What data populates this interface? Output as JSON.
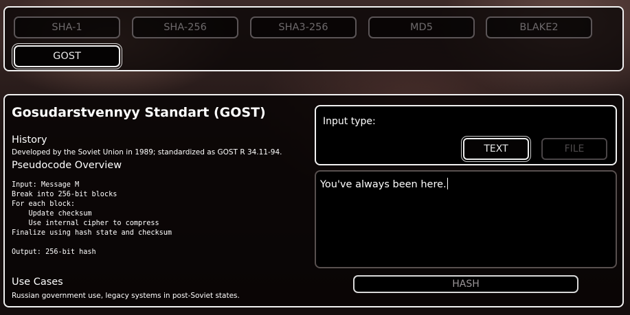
{
  "algorithms": {
    "items": [
      {
        "label": "SHA-1"
      },
      {
        "label": "SHA-256"
      },
      {
        "label": "SHA3-256"
      },
      {
        "label": "MD5"
      },
      {
        "label": "BLAKE2"
      },
      {
        "label": "GOST"
      }
    ],
    "selected": "GOST"
  },
  "info": {
    "title": "Gosudarstvennyy Standart (GOST)",
    "history_heading": "History",
    "history_text": "Developed by the Soviet Union in 1989; standardized as GOST R 34.11-94.",
    "pseudocode_heading": "Pseudocode Overview",
    "pseudocode": "Input: Message M\nBreak into 256-bit blocks\nFor each block:\n    Update checksum\n    Use internal cipher to compress\nFinalize using hash state and checksum\n\nOutput: 256-bit hash",
    "use_cases_heading": "Use Cases",
    "use_cases_text": "Russian government use, legacy systems in post-Soviet states."
  },
  "input_type": {
    "label": "Input type:",
    "text_button": "TEXT",
    "file_button": "FILE",
    "selected": "TEXT"
  },
  "text_input": {
    "value": "You've always been here."
  },
  "hash_button": {
    "label": "HASH"
  }
}
